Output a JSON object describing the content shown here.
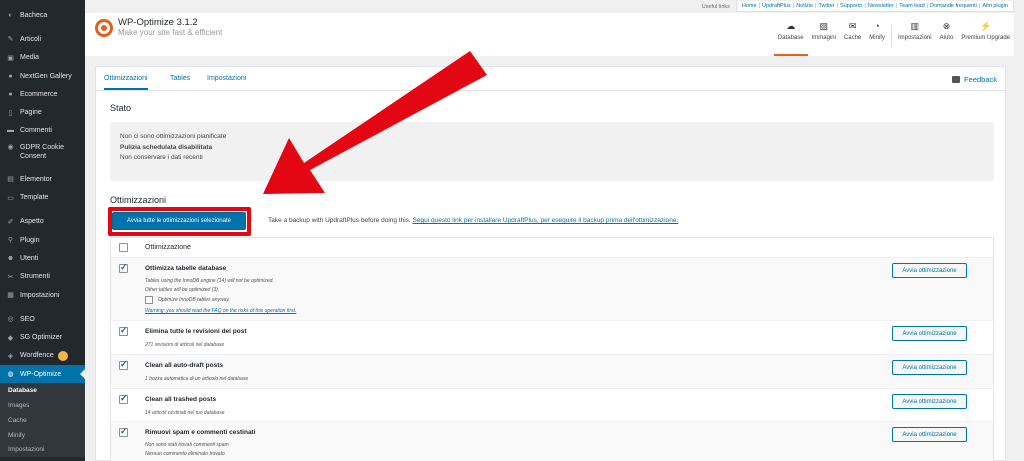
{
  "sidebar": {
    "items": [
      {
        "icon": "dashboard-icon",
        "label": "Bacheca"
      },
      {
        "icon": "pin-icon",
        "label": "Articoli"
      },
      {
        "icon": "media-icon",
        "label": "Media"
      },
      {
        "icon": "gallery-icon",
        "label": "NextGen Gallery"
      },
      {
        "icon": "ecommerce-icon",
        "label": "Ecommerce"
      },
      {
        "icon": "page-icon",
        "label": "Pagine"
      },
      {
        "icon": "comment-icon",
        "label": "Commenti"
      },
      {
        "icon": "cookie-icon",
        "label": "GDPR Cookie Consent"
      },
      {
        "icon": "elementor-icon",
        "label": "Elementor"
      },
      {
        "icon": "template-icon",
        "label": "Template"
      },
      {
        "icon": "brush-icon",
        "label": "Aspetto"
      },
      {
        "icon": "plugin-icon",
        "label": "Plugin"
      },
      {
        "icon": "users-icon",
        "label": "Utenti"
      },
      {
        "icon": "tools-icon",
        "label": "Strumenti"
      },
      {
        "icon": "settings-icon",
        "label": "Impostazioni"
      },
      {
        "icon": "seo-icon",
        "label": "SEO"
      },
      {
        "icon": "sg-optimizer-icon",
        "label": "SG Optimizer"
      },
      {
        "icon": "wordfence-icon",
        "label": "Wordfence"
      },
      {
        "icon": "wp-optimize-icon",
        "label": "WP-Optimize"
      }
    ],
    "submenu": [
      "Database",
      "Images",
      "Cache",
      "Minify",
      "Impostazioni"
    ]
  },
  "toplinks": {
    "label": "Useful links",
    "links": [
      "Home",
      "UpdraftPlus",
      "Notizie",
      "Twitter",
      "Supporto",
      "Newsletter",
      "Team lead",
      "Domande frequenti",
      "Altri plugin"
    ]
  },
  "plugin": {
    "title": "WP-Optimize 3.1.2",
    "tagline": "Make your site fast & efficient",
    "nav": [
      {
        "icon": "database-icon",
        "label": "Database"
      },
      {
        "icon": "images-icon",
        "label": "Immagini"
      },
      {
        "icon": "cache-icon",
        "label": "Cache"
      },
      {
        "icon": "minify-icon",
        "label": "Minify"
      },
      {
        "icon": "settings-grid-icon",
        "label": "Impostazioni"
      },
      {
        "icon": "help-icon",
        "label": "Aiuto"
      },
      {
        "icon": "premium-icon",
        "label": "Premium Upgrade"
      }
    ]
  },
  "tabs": [
    "Ottimizzazioni",
    "Tables",
    "Impostazioni"
  ],
  "feedback": "Feedback",
  "stato": {
    "heading": "Stato",
    "lines": [
      "Non ci sono ottimizzazioni pianificate",
      "Pulizia schedulata disabilitata",
      "Non conservare i dati recenti"
    ]
  },
  "ottimizzazioni": {
    "heading": "Ottimizzazioni",
    "run_all": "Avvia tutte le ottimizzazioni selezionate",
    "backup_text": "Take a backup with UpdraftPlus before doing this.",
    "backup_link": "Segui questo link per installare UpdraftPlus, per eseguire il backup prima dell'ottimizzazione.",
    "column_header": "Ottimizzazione",
    "run_label": "Avvia ottimizzazione",
    "rows": [
      {
        "title": "Ottimizza tabelle database",
        "notes": [
          "Tables using the InnoDB engine (14) will not be optimized.",
          "Other tables will be optimized (3)."
        ],
        "option": "Optimize InnoDB tables anyway.",
        "warning": "Warning: you should read the FAQ on the risks of this operation first."
      },
      {
        "title": "Elimina tutte le revisioni dei post",
        "notes": [
          "271 revisioni di articoli nel database"
        ]
      },
      {
        "title": "Clean all auto-draft posts",
        "notes": [
          "1 bozza automatica di un articolo nel database"
        ]
      },
      {
        "title": "Clean all trashed posts",
        "notes": [
          "14 articoli cestinati nel tuo database"
        ]
      },
      {
        "title": "Rimuovi spam e commenti cestinati",
        "notes": [
          "Non sono stati trovati commenti spam",
          "Nessun commento eliminato trovato"
        ]
      }
    ]
  },
  "colors": {
    "accent": "#0073aa",
    "brand": "#e2601a",
    "highlight": "#e30613"
  }
}
